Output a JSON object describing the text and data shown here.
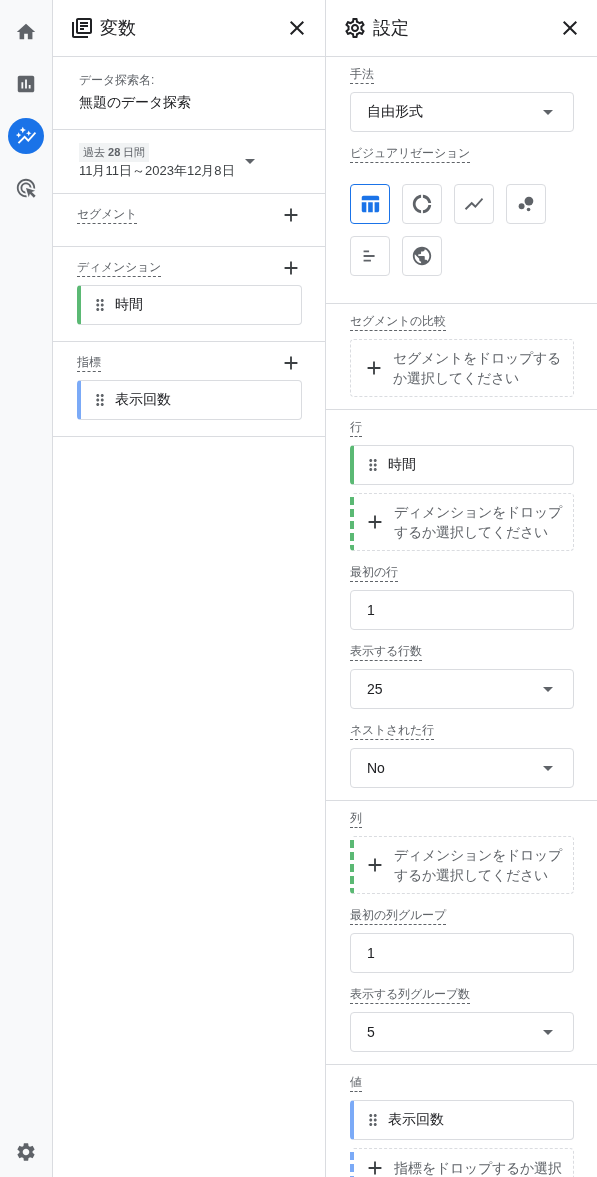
{
  "nav": [
    {
      "selected": false
    },
    {
      "selected": false
    },
    {
      "selected": true
    },
    {
      "selected": false
    }
  ],
  "variables": {
    "title": "変数",
    "name_label": "データ探索名:",
    "name_value": "無題のデータ探索",
    "date_chip": "過去 **28** 日間",
    "date_range": "11月11日～2023年12月8日",
    "sections": [
      {
        "title": "セグメント"
      },
      {
        "title": "ディメンション",
        "items": [
          {
            "label": "時間",
            "color": "#5bb974"
          }
        ]
      },
      {
        "title": "指標",
        "items": [
          {
            "label": "表示回数",
            "color": "#7baaf7"
          }
        ]
      }
    ]
  },
  "settings": {
    "title": "設定",
    "sections": [
      {
        "fields": [
          {
            "kind": "select",
            "label": "手法",
            "value": "自由形式"
          },
          {
            "kind": "visuals",
            "label": "ビジュアリゼーション",
            "options": [
              {
                "selected": true
              },
              {
                "selected": false
              },
              {
                "selected": false
              },
              {
                "selected": false
              },
              {
                "selected": false
              },
              {
                "selected": false
              }
            ]
          }
        ]
      },
      {
        "fields": [
          {
            "kind": "drop",
            "label": "セグメントの比較",
            "text": "セグメントをドロップするか選択してください"
          }
        ]
      },
      {
        "fields": [
          {
            "kind": "items",
            "label": "行",
            "items": [
              {
                "label": "時間",
                "color": "#5bb974"
              }
            ]
          },
          {
            "kind": "drop",
            "text": "ディメンションをドロップするか選択してください",
            "color": "#5bb974"
          },
          {
            "kind": "input",
            "label": "最初の行",
            "value": "1"
          },
          {
            "kind": "select",
            "label": "表示する行数",
            "value": "25"
          },
          {
            "kind": "select",
            "label": "ネストされた行",
            "value": "No"
          }
        ]
      },
      {
        "fields": [
          {
            "kind": "drop",
            "label": "列",
            "text": "ディメンションをドロップするか選択してください",
            "color": "#5bb974"
          },
          {
            "kind": "input",
            "label": "最初の列グループ",
            "value": "1"
          },
          {
            "kind": "select",
            "label": "表示する列グループ数",
            "value": "5"
          }
        ]
      },
      {
        "fields": [
          {
            "kind": "items",
            "label": "値",
            "items": [
              {
                "label": "表示回数",
                "color": "#7baaf7"
              }
            ]
          },
          {
            "kind": "drop",
            "text": "指標をドロップするか選択",
            "color": "#7baaf7"
          }
        ]
      }
    ]
  }
}
